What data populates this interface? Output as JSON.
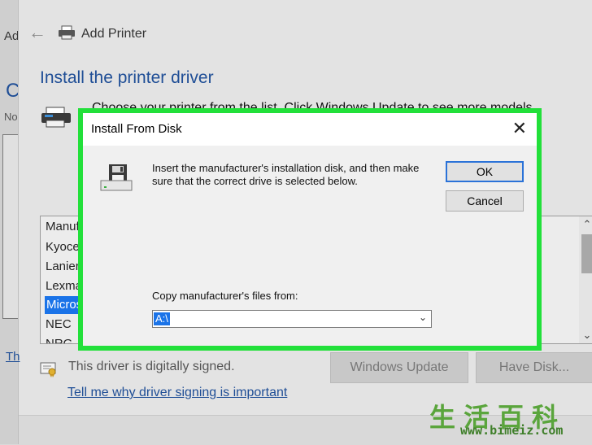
{
  "background_window": {
    "title_fragment": "Ad",
    "heading_fragment": "C",
    "text_fragment": "No",
    "link_fragment": "Th"
  },
  "wizard": {
    "title": "Add Printer",
    "close_glyph": "✕",
    "heading": "Install the printer driver",
    "description": "Choose your printer from the list. Click Windows Update to see more models.",
    "manufacturers": [
      "Manuf",
      "Kyocer",
      "Lanier",
      "Lexma",
      "Micros",
      "NEC",
      "NRG"
    ],
    "selected_manufacturer_index": 4,
    "signed_text": "This driver is digitally signed.",
    "windows_update_label": "Windows Update",
    "have_disk_label": "Have Disk...",
    "signing_link": "Tell me why driver signing is important"
  },
  "dialog": {
    "title": "Install From Disk",
    "message": "Insert the manufacturer's installation disk, and then make sure that the correct drive is selected below.",
    "ok_label": "OK",
    "cancel_label": "Cancel",
    "copy_label": "Copy manufacturer's files from:",
    "copy_value": "A:\\",
    "close_glyph": "✕"
  },
  "watermark": {
    "chinese": "生活百科",
    "url": "www.bimeiz.com"
  },
  "colors": {
    "highlight": "#22e03a",
    "selection": "#1a73e8",
    "heading": "#1f4e96",
    "ok_border": "#2a72d8"
  },
  "icons": [
    "back-arrow-icon",
    "printer-icon",
    "floppy-disk-icon",
    "certificate-icon",
    "chevron-down-icon",
    "scroll-up-icon",
    "scroll-down-icon",
    "close-icon"
  ]
}
